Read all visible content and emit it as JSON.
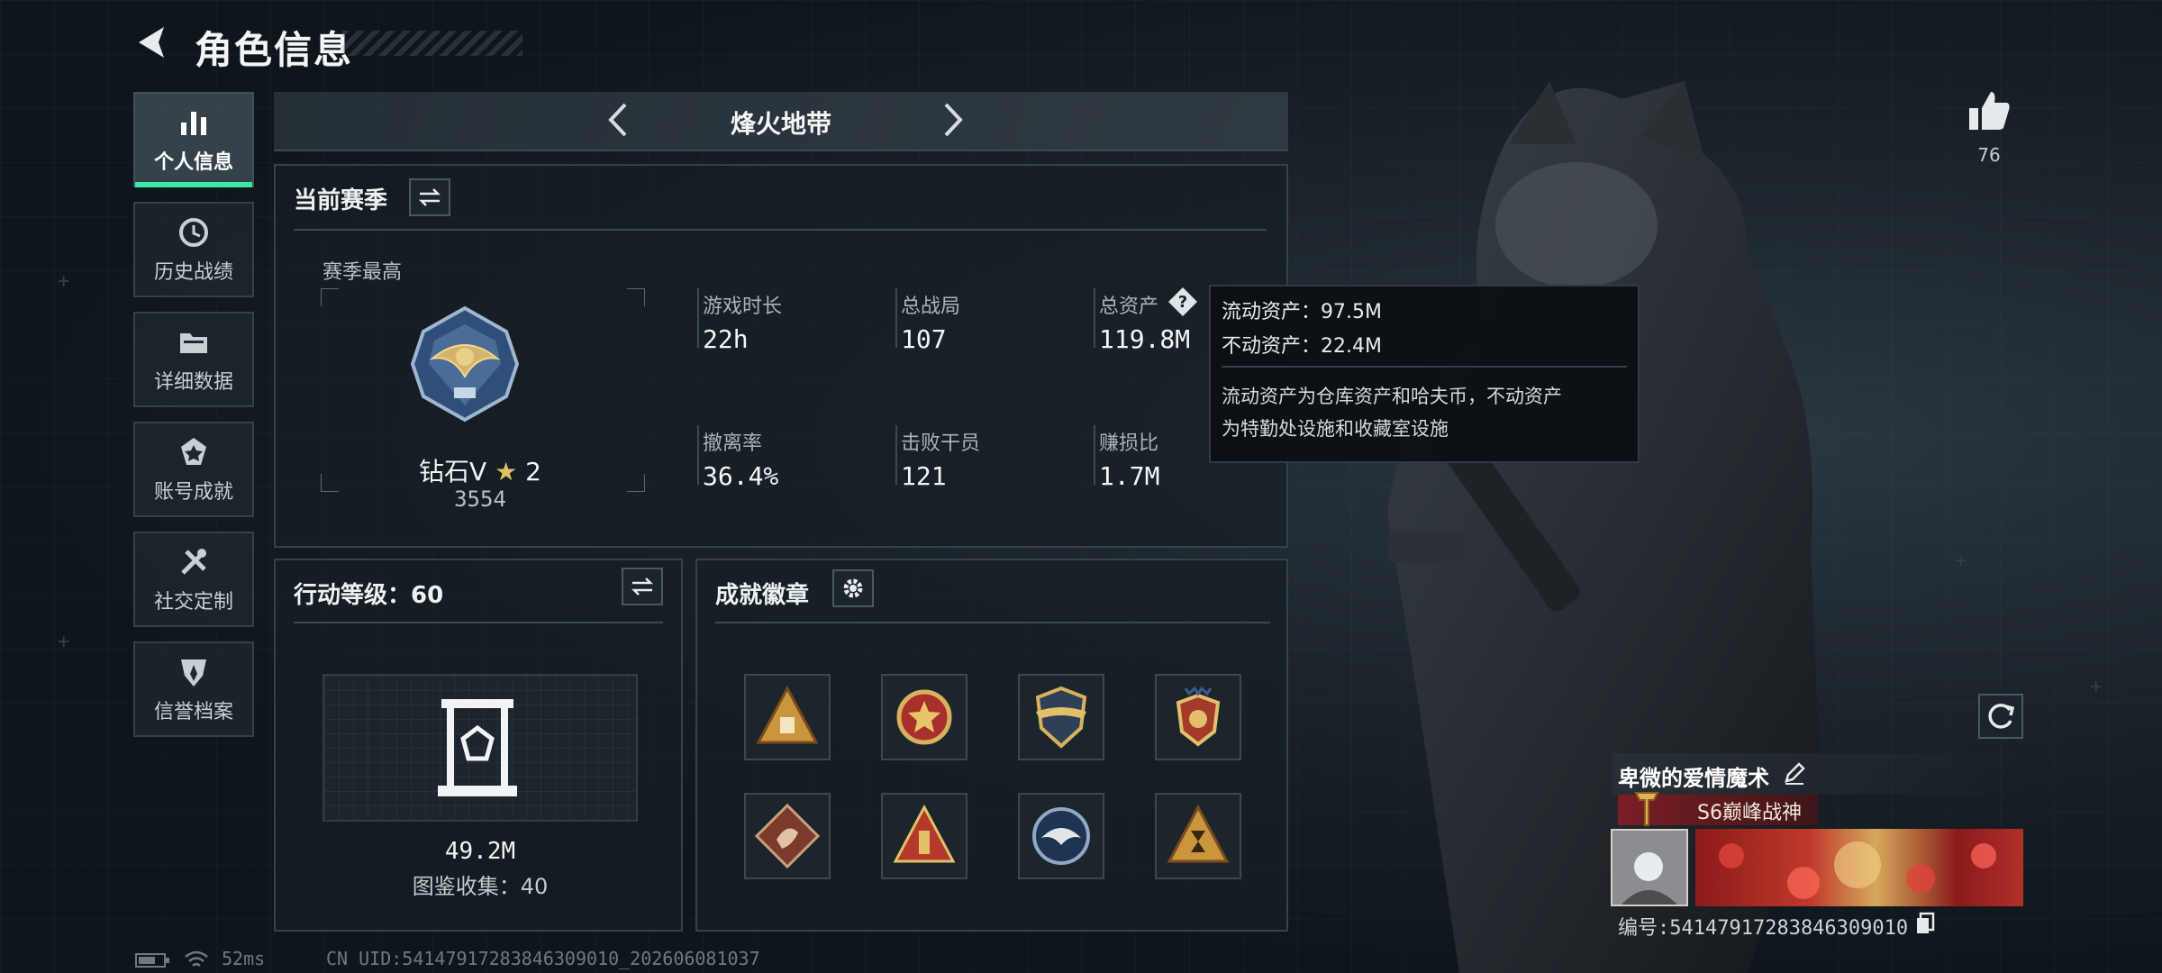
{
  "header": {
    "title": "角色信息"
  },
  "nav": {
    "items": [
      {
        "label": "个人信息",
        "icon": "bar-chart-icon",
        "active": true
      },
      {
        "label": "历史战绩",
        "icon": "history-clock-icon",
        "active": false
      },
      {
        "label": "详细数据",
        "icon": "folder-icon",
        "active": false
      },
      {
        "label": "账号成就",
        "icon": "achievement-medal-icon",
        "active": false
      },
      {
        "label": "社交定制",
        "icon": "tools-icon",
        "active": false
      },
      {
        "label": "信誉档案",
        "icon": "shield-badge-icon",
        "active": false
      }
    ]
  },
  "mode": {
    "title": "烽火地带"
  },
  "season": {
    "title": "当前赛季",
    "best_label": "赛季最高",
    "rank_name": "钻石V",
    "rank_stars": "2",
    "rank_score": "3554",
    "stats": [
      {
        "label": "游戏时长",
        "value": "22h"
      },
      {
        "label": "总战局",
        "value": "107"
      },
      {
        "label": "总资产",
        "value": "119.8M"
      },
      {
        "label": "撤离率",
        "value": "36.4%"
      },
      {
        "label": "击败干员",
        "value": "121"
      },
      {
        "label": "赚损比",
        "value": "1.7M"
      }
    ]
  },
  "tooltip": {
    "line1": "流动资产：97.5M",
    "line2": "不动资产：22.4M",
    "desc1": "流动资产为仓库资产和哈夫币，不动资产",
    "desc2": "为特勤处设施和收藏室设施"
  },
  "action_level": {
    "title": "行动等级：60",
    "value": "49.2M",
    "collection": "图鉴收集：40"
  },
  "badges": {
    "title": "成就徽章",
    "items": [
      "triangle-badge-icon",
      "star-medal-icon",
      "shield-wing-icon",
      "eagle-crest-icon",
      "dragon-diamond-icon",
      "triangle-tower-icon",
      "eagle-round-icon",
      "hourglass-triangle-icon"
    ]
  },
  "likes": {
    "count": "76"
  },
  "player": {
    "name": "卑微的爱情魔术",
    "title": "S6巅峰战神",
    "id": "编号:54147917283846309010"
  },
  "status": {
    "ping": "52ms",
    "uid": "CN UID:54147917283846309010_202606081037"
  },
  "colors": {
    "accent": "#3ce8a8",
    "title_badge": "#7a1e24"
  }
}
